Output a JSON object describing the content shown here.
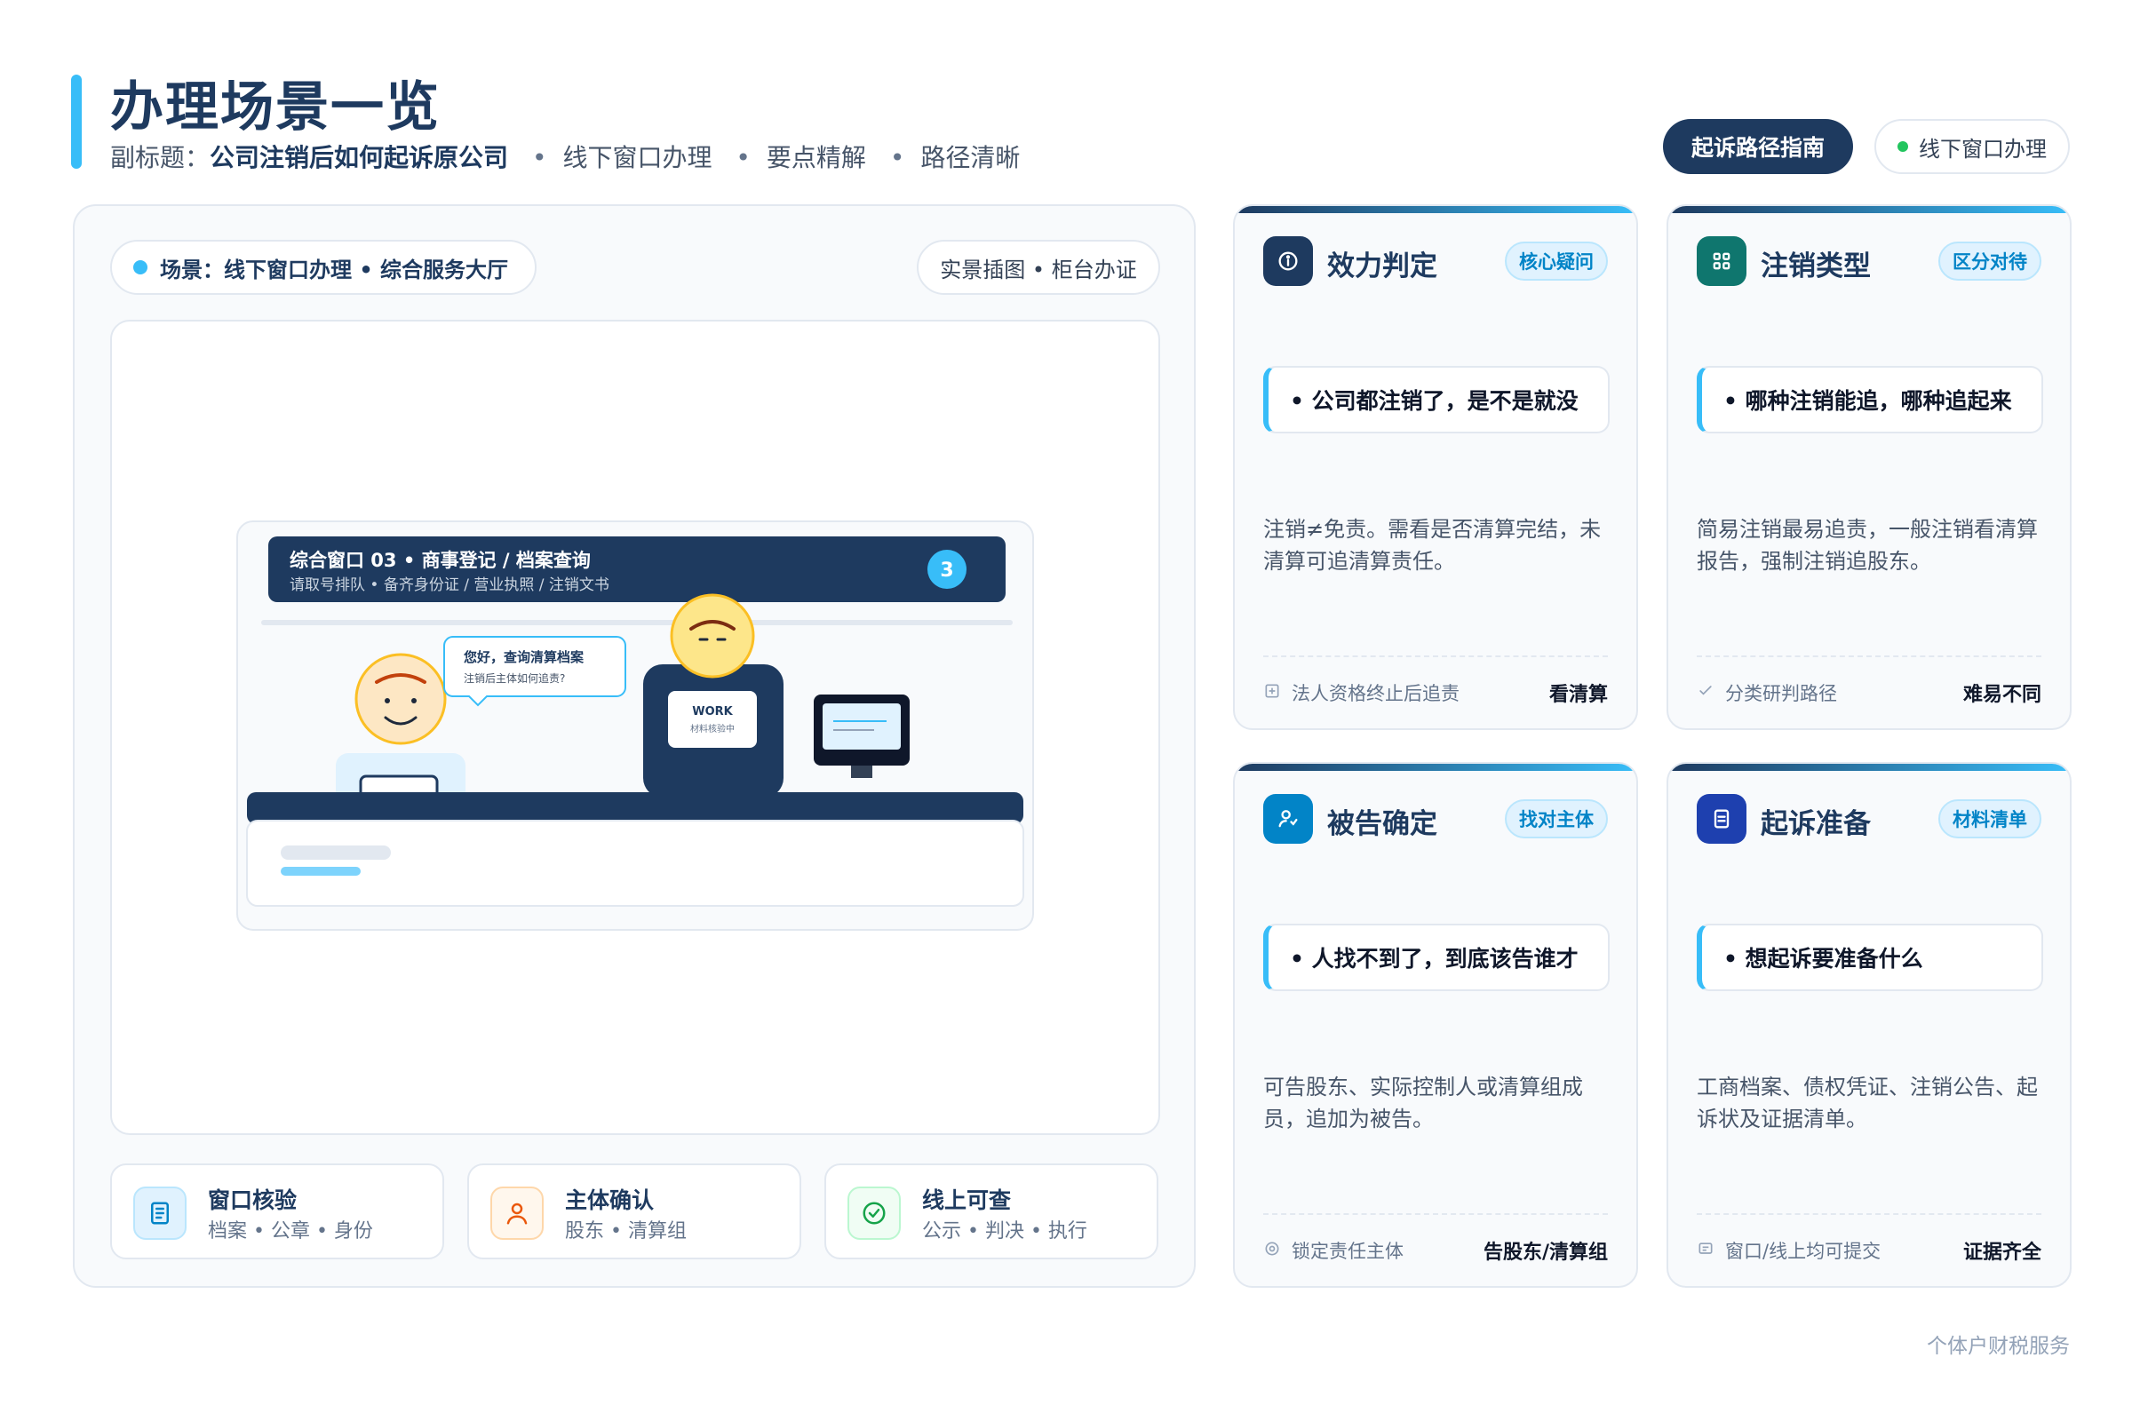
{
  "header": {
    "title": "办理场景一览",
    "subtitle_prefix": "副标题：",
    "subtitle_main": "公司注销后如何起诉原公司",
    "subtitle_tags": [
      "线下窗口办理",
      "要点精解",
      "路径清晰"
    ],
    "separator": "•",
    "guide_button": "起诉路径指南",
    "window_pill": "线下窗口办理"
  },
  "scene": {
    "label": "场景：线下窗口办理 • 综合服务大厅",
    "tag": "实景插图 • 柜台办证",
    "illustration": {
      "window_title": "综合窗口 03 • 商事登记 / 档案查询",
      "window_sub": "请取号排队 • 备齐身份证 / 营业执照 / 注销文书",
      "queue_number": "3",
      "bubble_title": "您好，查询清算档案",
      "bubble_sub": "注销后主体如何追责?",
      "clerk_badge_title": "WORK",
      "clerk_badge_sub": "材料核验中"
    },
    "features": [
      {
        "title": "窗口核验",
        "sub": "档案 • 公章 • 身份",
        "icon": "document-icon"
      },
      {
        "title": "主体确认",
        "sub": "股东 • 清算组",
        "icon": "person-icon"
      },
      {
        "title": "线上可查",
        "sub": "公示 • 判决 • 执行",
        "icon": "check-circle-icon"
      }
    ]
  },
  "cards": [
    {
      "title": "效力判定",
      "badge": "核心疑问",
      "question": "• 公司都注销了，是不是就没",
      "desc": "注销≠免责。需看是否清算完结，未清算可追清算责任。",
      "foot_left": "法人资格终止后追责",
      "foot_right": "看清算",
      "icon": "info-icon",
      "foot_icon": "plus-square-icon"
    },
    {
      "title": "注销类型",
      "badge": "区分对待",
      "question": "• 哪种注销能追，哪种追起来",
      "desc": "简易注销最易追责，一般注销看清算报告，强制注销追股东。",
      "foot_left": "分类研判路径",
      "foot_right": "难易不同",
      "icon": "grid-icon",
      "foot_icon": "check-icon"
    },
    {
      "title": "被告确定",
      "badge": "找对主体",
      "question": "• 人找不到了，到底该告谁才",
      "desc": "可告股东、实际控制人或清算组成员，追加为被告。",
      "foot_left": "锁定责任主体",
      "foot_right": "告股东/清算组",
      "icon": "user-search-icon",
      "foot_icon": "target-icon"
    },
    {
      "title": "起诉准备",
      "badge": "材料清单",
      "question": "• 想起诉要准备什么",
      "desc": "工商档案、债权凭证、注销公告、起诉状及证据清单。",
      "foot_left": "窗口/线上均可提交",
      "foot_right": "证据齐全",
      "icon": "file-icon",
      "foot_icon": "message-icon"
    }
  ],
  "colors": {
    "navy": "#1e3a5f",
    "accent": "#38bdf8",
    "green": "#22c55e",
    "card_icon_1": "#1e3a5f",
    "card_icon_2": "#0f766e",
    "card_icon_3": "#0284c7",
    "card_icon_4": "#1e40af"
  },
  "brand": "个体户财税服务"
}
